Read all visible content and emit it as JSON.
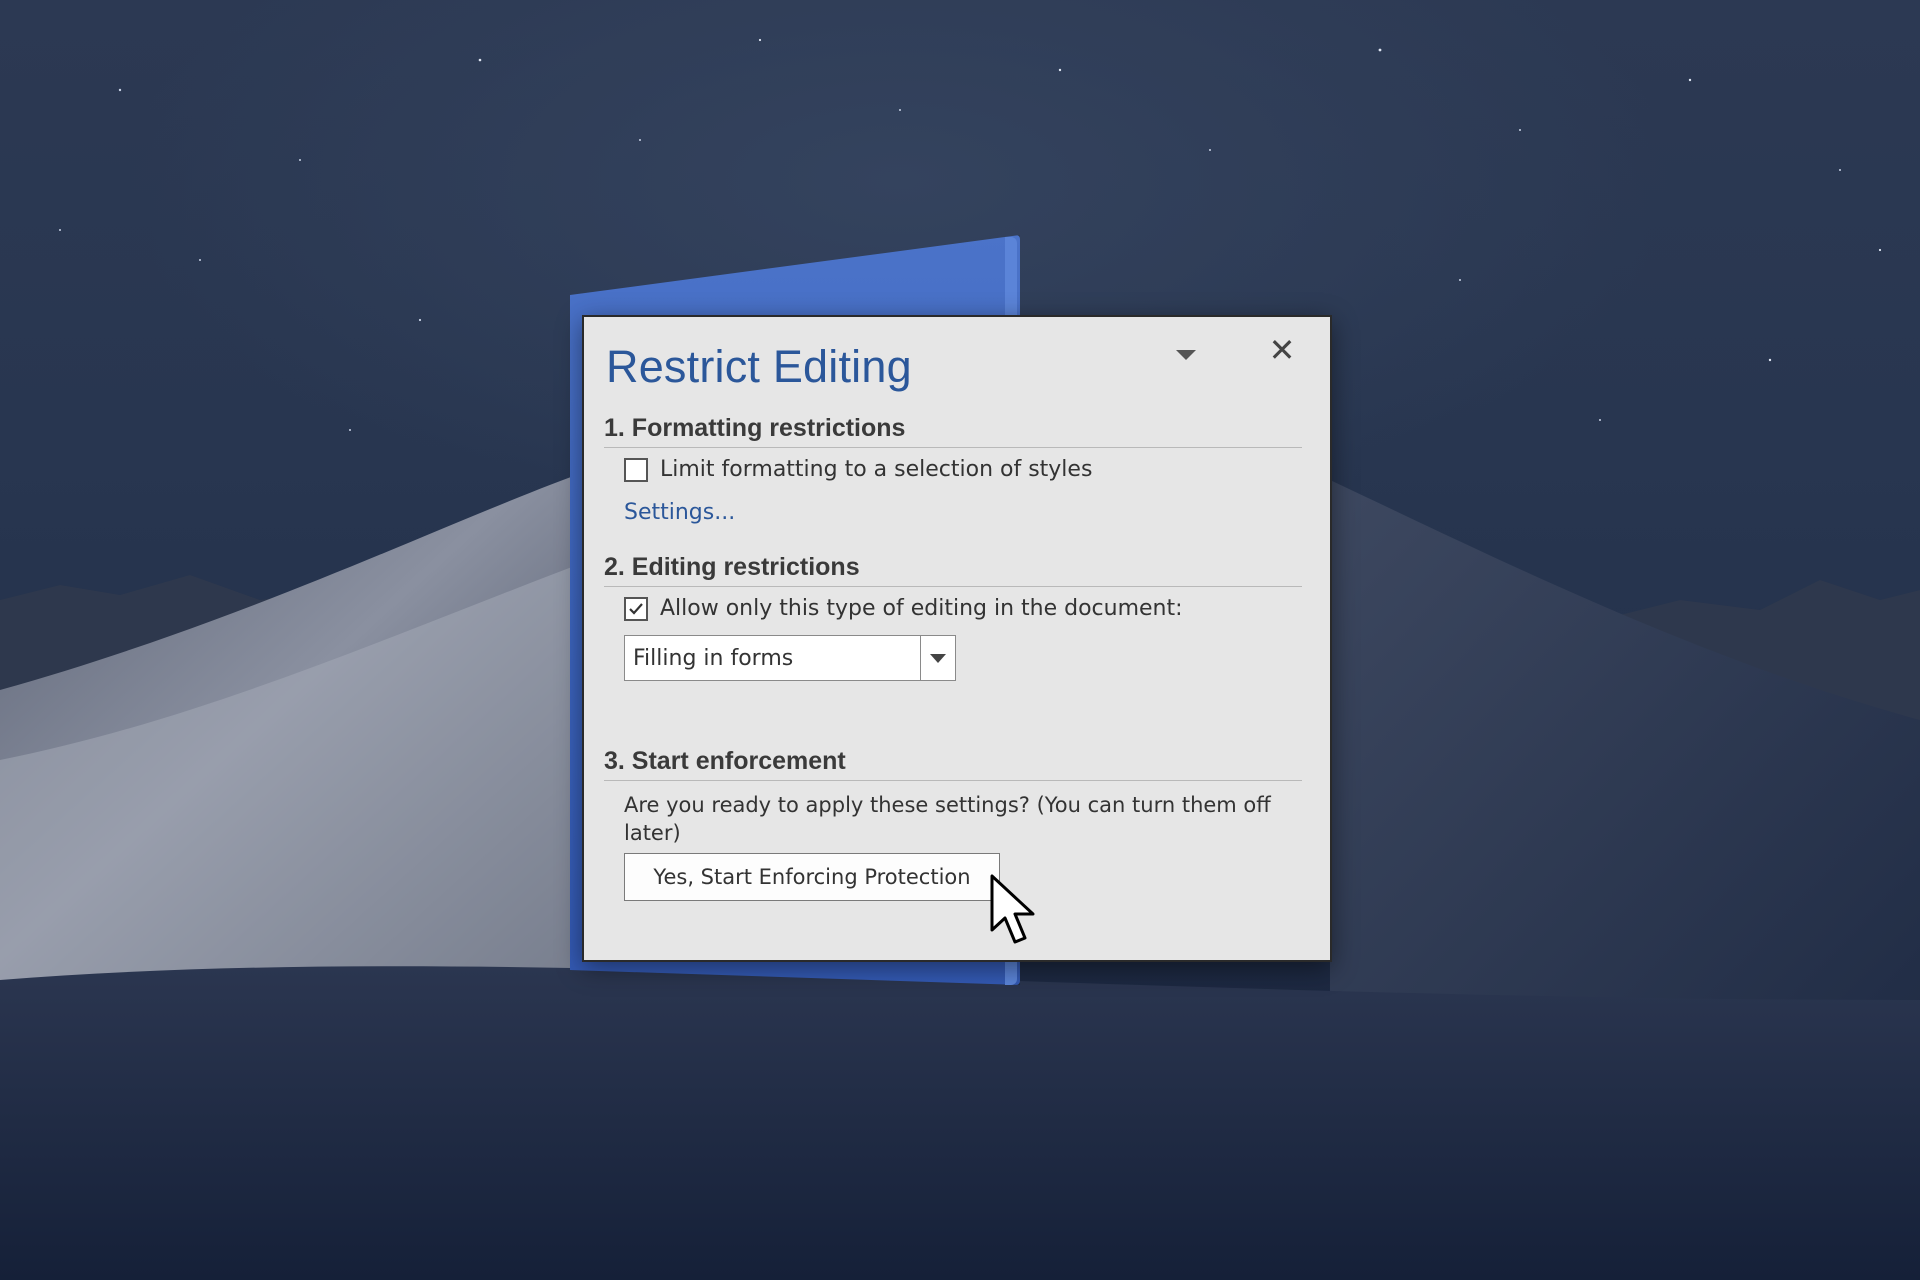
{
  "panel": {
    "title": "Restrict Editing",
    "close_glyph": "✕",
    "dropdown_icon": "chevron-down-icon",
    "close_icon": "close-icon"
  },
  "sections": {
    "formatting": {
      "heading": "1. Formatting restrictions",
      "checkbox_label": "Limit formatting to a selection of styles",
      "checkbox_checked": false,
      "settings_link": "Settings..."
    },
    "editing": {
      "heading": "2. Editing restrictions",
      "checkbox_label": "Allow only this type of editing in the document:",
      "checkbox_checked": true,
      "select_value": "Filling in forms"
    },
    "enforcement": {
      "heading": "3. Start enforcement",
      "prompt": "Are you ready to apply these settings? (You can turn them off later)",
      "button_label": "Yes, Start Enforcing Protection"
    }
  },
  "colors": {
    "title_blue": "#2b579a",
    "panel_bg": "#e6e6e6",
    "doc_card_blue": "#3b63bd"
  }
}
